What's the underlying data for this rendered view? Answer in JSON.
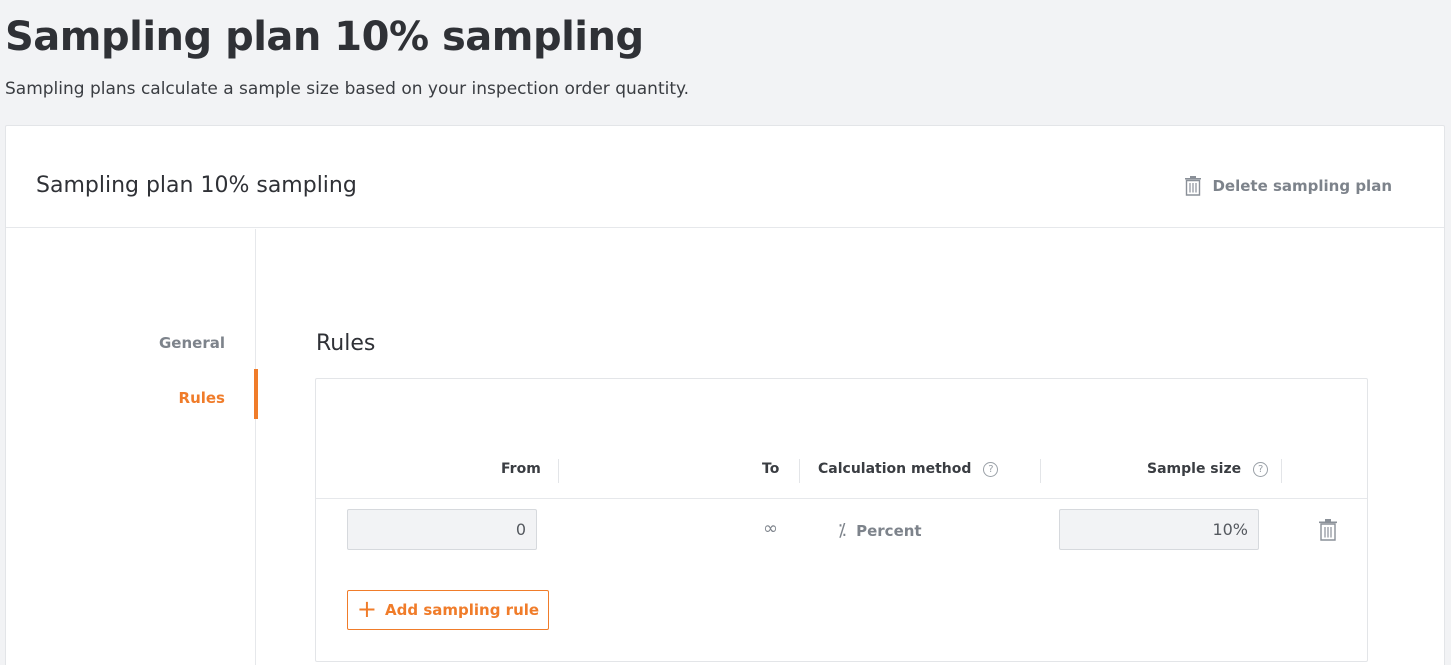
{
  "page": {
    "title": "Sampling plan 10% sampling",
    "subtitle": "Sampling plans calculate a sample size based on your inspection order quantity."
  },
  "card": {
    "title": "Sampling plan 10% sampling",
    "delete_label": "Delete sampling plan"
  },
  "nav": {
    "items": [
      {
        "label": "General",
        "active": false
      },
      {
        "label": "Rules",
        "active": true
      }
    ]
  },
  "rules": {
    "title": "Rules",
    "columns": {
      "from": "From",
      "to": "To",
      "method": "Calculation method",
      "size": "Sample size"
    },
    "rows": [
      {
        "from": "0",
        "to": "∞",
        "method": "Percent",
        "size": "10%"
      }
    ],
    "add_label": "Add sampling rule"
  },
  "colors": {
    "accent": "#f07c2a",
    "muted": "#7d838b",
    "text": "#2f3136",
    "background": "#f2f3f5"
  }
}
